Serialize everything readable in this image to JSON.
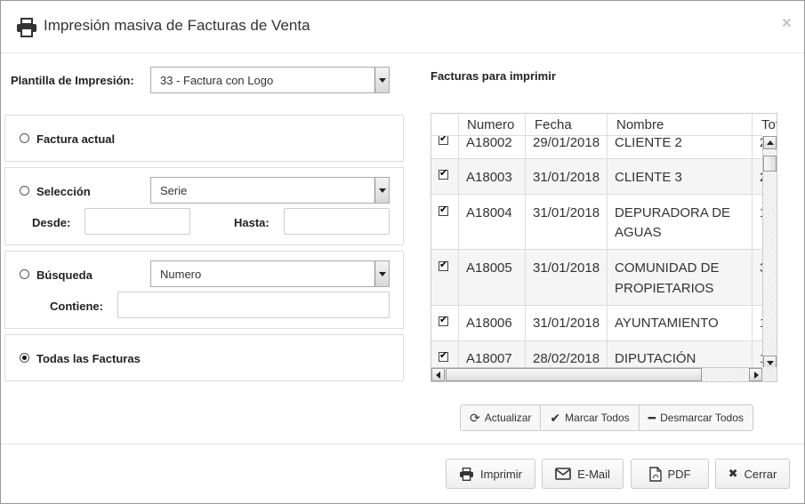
{
  "header": {
    "title": "Impresión masiva de Facturas de Venta",
    "close": "×"
  },
  "plantilla": {
    "label": "Plantilla de Impresión:",
    "value": "33 - Factura con Logo"
  },
  "options": {
    "factura_actual": "Factura actual",
    "seleccion": "Selección",
    "seleccion_select": "Serie",
    "desde": "Desde:",
    "hasta": "Hasta:",
    "busqueda": "Búsqueda",
    "busqueda_select": "Numero",
    "contiene": "Contiene:",
    "todas": "Todas las Facturas",
    "selected": "todas"
  },
  "grid": {
    "title": "Facturas para imprimir",
    "columns": [
      "Numero",
      "Fecha",
      "Nombre",
      "Tot"
    ],
    "rows": [
      {
        "checked": true,
        "numero": "A18002",
        "fecha": "29/01/2018",
        "nombre": [
          "CLIENTE 2"
        ],
        "total": "2"
      },
      {
        "checked": true,
        "numero": "A18003",
        "fecha": "31/01/2018",
        "nombre": [
          "CLIENTE 3"
        ],
        "total": "2"
      },
      {
        "checked": true,
        "numero": "A18004",
        "fecha": "31/01/2018",
        "nombre": [
          "DEPURADORA DE",
          "AGUAS"
        ],
        "total": "1"
      },
      {
        "checked": true,
        "numero": "A18005",
        "fecha": "31/01/2018",
        "nombre": [
          "COMUNIDAD DE",
          "PROPIETARIOS"
        ],
        "total": "3"
      },
      {
        "checked": true,
        "numero": "A18006",
        "fecha": "31/01/2018",
        "nombre": [
          "AYUNTAMIENTO"
        ],
        "total": "1"
      },
      {
        "checked": true,
        "numero": "A18007",
        "fecha": "28/02/2018",
        "nombre": [
          "DIPUTACIÓN"
        ],
        "total": "1"
      }
    ]
  },
  "actions": {
    "actualizar": "Actualizar",
    "marcar": "Marcar Todos",
    "desmarcar": "Desmarcar Todos"
  },
  "footer": {
    "imprimir": "Imprimir",
    "email": "E-Mail",
    "pdf": "PDF",
    "cerrar": "Cerrar"
  }
}
